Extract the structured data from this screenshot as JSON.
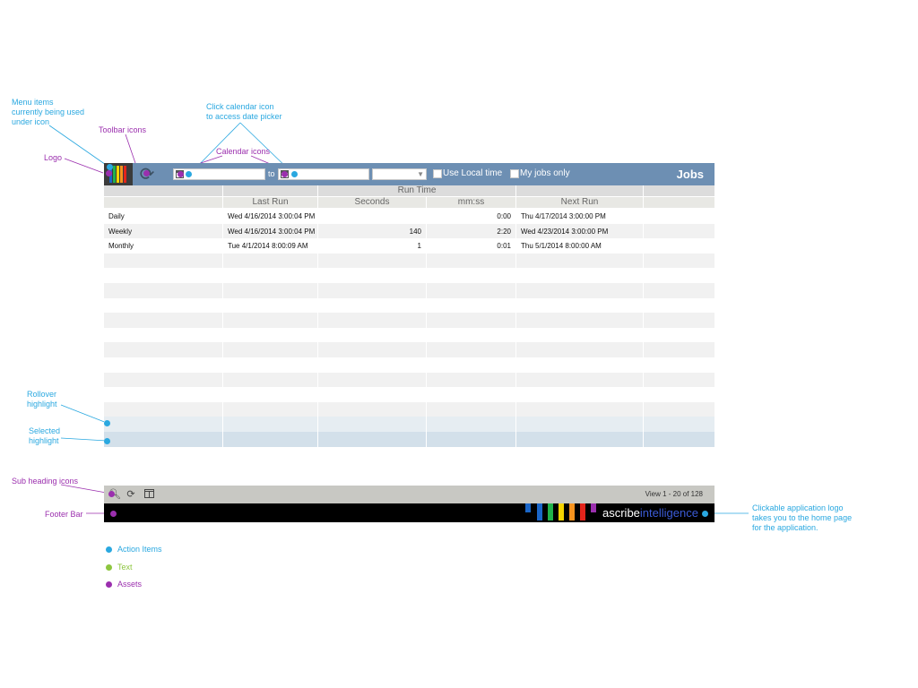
{
  "annotations": {
    "menu_items_line1": "Menu items",
    "menu_items_line2": "currently being used",
    "menu_items_line3": "under icon",
    "toolbar_icons": "Toolbar icons",
    "logo": "Logo",
    "calendar_hint_line1": "Click calendar icon",
    "calendar_hint_line2": "to access date picker",
    "calendar_icons": "Calendar icons",
    "rollover_line1": "Rollover",
    "rollover_line2": "highlight",
    "selected_line1": "Selected",
    "selected_line2": "highlight",
    "sub_heading_icons": "Sub heading icons",
    "footer_bar": "Footer Bar",
    "app_logo_line1": "Clickable application logo",
    "app_logo_line2": "takes you to the home page",
    "app_logo_line3": "for the application."
  },
  "legend": {
    "action_items": "Action Items",
    "text": "Text",
    "assets": "Assets"
  },
  "toolbar": {
    "date_separator": "to",
    "use_local_time": "Use Local time",
    "my_jobs_only": "My jobs only",
    "title": "Jobs",
    "icons": [
      "refresh-icon",
      "calendar-icon",
      "chevron-down-icon"
    ]
  },
  "table": {
    "group_header": "Run Time",
    "columns": [
      "",
      "Last Run",
      "Seconds",
      "mm:ss",
      "Next Run",
      ""
    ],
    "rows": [
      {
        "name": "Daily",
        "last_run": "Wed 4/16/2014 3:00:04 PM",
        "seconds": "",
        "mmss": "0:00",
        "next_run": "Thu 4/17/2014 3:00:00 PM"
      },
      {
        "name": "Weekly",
        "last_run": "Wed 4/16/2014 3:00:04 PM",
        "seconds": "140",
        "mmss": "2:20",
        "next_run": "Wed 4/23/2014 3:00:00 PM"
      },
      {
        "name": "Monthly",
        "last_run": "Tue 4/1/2014 8:00:09 AM",
        "seconds": "1",
        "mmss": "0:01",
        "next_run": "Thu 5/1/2014 8:00:00 AM"
      }
    ],
    "total_rows": 17
  },
  "subbar": {
    "view_count": "View 1 - 20 of 128",
    "icons": [
      "search-icon",
      "refresh-icon",
      "columns-icon"
    ]
  },
  "footer": {
    "logo_part1": "ascribe",
    "logo_part2": "intelligence"
  },
  "colors": {
    "toolbar": "#6d8fb3",
    "footer": "#000000",
    "action_dot": "#2aa8e0",
    "text_dot": "#8dc63f",
    "asset_dot": "#9b2fae",
    "row_stripe": "#f1f1f1",
    "rollover": "#e6edf2",
    "selected": "#d3e0ea"
  }
}
